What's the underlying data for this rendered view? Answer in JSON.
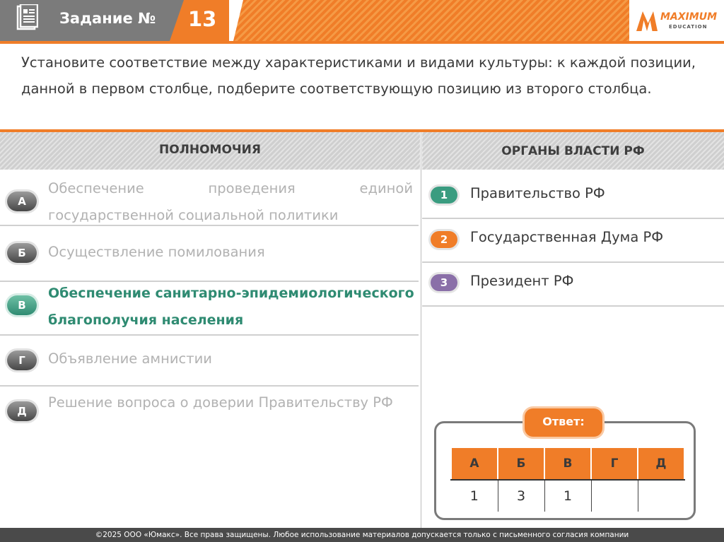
{
  "header": {
    "title": "Задание №",
    "task_number": "13",
    "logo_text": "MAXIMUM",
    "logo_subtext": "EDUCATION"
  },
  "task_text": "Установите соответствие между характеристиками и видами культуры: к каждой позиции, данной в первом столбце, подберите соответствующую позицию из второго столбца.",
  "columns": {
    "left_title": "ПОЛНОМОЧИЯ",
    "right_title": "ОРГАНЫ ВЛАСТИ РФ"
  },
  "left_items": [
    {
      "letter": "А",
      "text": "Обеспечение проведения единой государственной социальной политики"
    },
    {
      "letter": "Б",
      "text": "Осуществление помилования"
    },
    {
      "letter": "В",
      "text": "Обеспечение санитарно-эпидемиологического благополучия населения"
    },
    {
      "letter": "Г",
      "text": "Объявление амнистии"
    },
    {
      "letter": "Д",
      "text": "Решение вопроса о доверии Правительству РФ"
    }
  ],
  "right_items": [
    {
      "number": "1",
      "text": "Правительство РФ",
      "color": "#3a9c80"
    },
    {
      "number": "2",
      "text": "Государственная Дума РФ",
      "color": "#f07d28"
    },
    {
      "number": "3",
      "text": "Президент РФ",
      "color": "#8a6fa8"
    }
  ],
  "answer": {
    "label": "Ответ:",
    "headers": [
      "А",
      "Б",
      "В",
      "Г",
      "Д"
    ],
    "values": [
      "1",
      "3",
      "1",
      "",
      ""
    ]
  },
  "footer": "©2025 ООО «Юмакс». Все права защищены. Любое использование материалов допускается только с  письменного согласия компании",
  "colors": {
    "accent": "#f07d28",
    "active_teal": "#2f8b72",
    "header_gray": "#7b7b7b"
  }
}
